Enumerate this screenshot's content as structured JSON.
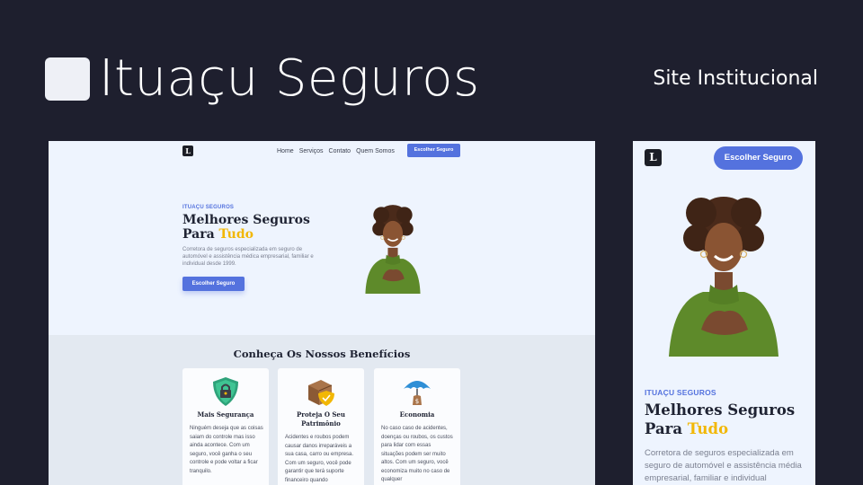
{
  "header": {
    "brand": "Ituaçu Seguros",
    "subtitle": "Site Institucional"
  },
  "desktop": {
    "logo_letter": "L",
    "nav": [
      "Home",
      "Serviços",
      "Contato",
      "Quem Somos"
    ],
    "cta": "Escolher Seguro",
    "hero": {
      "eyebrow": "ITUAÇU SEGUROS",
      "title_line1": "Melhores Seguros",
      "title_prefix": "Para ",
      "title_highlight": "Tudo",
      "text": "Corretora de seguros especializada em seguro de automóvel e assistência médica empresarial, familiar e individual desde 1999.",
      "button": "Escolher Seguro"
    },
    "benefits": {
      "title": "Conheça Os Nossos Benefícios",
      "cards": [
        {
          "icon": "shield-lock-icon",
          "title": "Mais Segurança",
          "text": "Ninguém deseja que as coisas saiam do controle mas isso ainda acontece. Com um seguro, você ganha o seu controle e pode voltar a ficar tranquilo."
        },
        {
          "icon": "box-shield-icon",
          "title": "Proteja O Seu Patrimônio",
          "text": "Acidentes e roubos podem causar danos irreparáveis a sua casa, carro ou empresa. Com um seguro, você pode garantir que terá suporte financeiro quando"
        },
        {
          "icon": "umbrella-money-icon",
          "title": "Economia",
          "text": "No caso caso de acidentes, doenças ou roubos, os custos para lidar com essas situações podem ser muito altos. Com um seguro, você economiza muito no caso de qualquer"
        }
      ]
    }
  },
  "mobile": {
    "logo_letter": "L",
    "cta": "Escolher Seguro",
    "eyebrow": "ITUAÇU SEGUROS",
    "title_line1": "Melhores Seguros",
    "title_prefix": "Para ",
    "title_highlight": "Tudo",
    "text": "Corretora de seguros especializada em seguro de automóvel e assistência média empresarial, familiar e individual"
  },
  "colors": {
    "background": "#1e1f2e",
    "accent": "#5472de",
    "highlight": "#f2b705",
    "shirt": "#5e8a2a"
  }
}
